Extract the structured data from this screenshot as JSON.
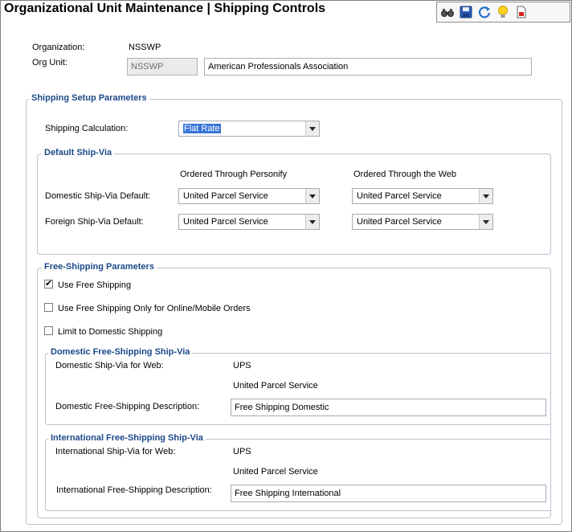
{
  "header": {
    "title": "Organizational Unit Maintenance | Shipping Controls"
  },
  "toolbar": {
    "icons": [
      "binoculars-icon",
      "save-icon",
      "refresh-icon",
      "lightbulb-icon",
      "report-icon"
    ]
  },
  "org": {
    "organization_label": "Organization:",
    "organization_value": "NSSWP",
    "org_unit_label": "Org Unit:",
    "org_unit_code": "NSSWP",
    "org_unit_name": "American Professionals Association"
  },
  "shipping_setup": {
    "legend": "Shipping Setup Parameters",
    "calculation_label": "Shipping Calculation:",
    "calculation_value": "Flat Rate"
  },
  "default_ship_via": {
    "legend": "Default Ship-Via",
    "col_personify": "Ordered Through Personify",
    "col_web": "Ordered Through the Web",
    "domestic_label": "Domestic Ship-Via Default:",
    "domestic_personify": "United Parcel Service",
    "domestic_web": "United Parcel Service",
    "foreign_label": "Foreign Ship-Via Default:",
    "foreign_personify": "United Parcel Service",
    "foreign_web": "United Parcel Service"
  },
  "free_shipping": {
    "legend": "Free-Shipping Parameters",
    "use_free_shipping": "Use Free Shipping",
    "use_free_shipping_checked": true,
    "online_only": "Use Free Shipping Only for Online/Mobile Orders",
    "online_only_checked": false,
    "domestic_only": "Limit to Domestic Shipping",
    "domestic_only_checked": false
  },
  "domestic_free": {
    "legend": "Domestic Free-Shipping Ship-Via",
    "ship_via_label": "Domestic Ship-Via for Web:",
    "ship_via_code": "UPS",
    "ship_via_name": "United Parcel Service",
    "description_label": "Domestic Free-Shipping Description:",
    "description_value": "Free Shipping Domestic"
  },
  "international_free": {
    "legend": "International Free-Shipping Ship-Via",
    "ship_via_label": "International Ship-Via for Web:",
    "ship_via_code": "UPS",
    "ship_via_name": "United Parcel Service",
    "description_label": "International Free-Shipping Description:",
    "description_value": "Free Shipping International"
  }
}
